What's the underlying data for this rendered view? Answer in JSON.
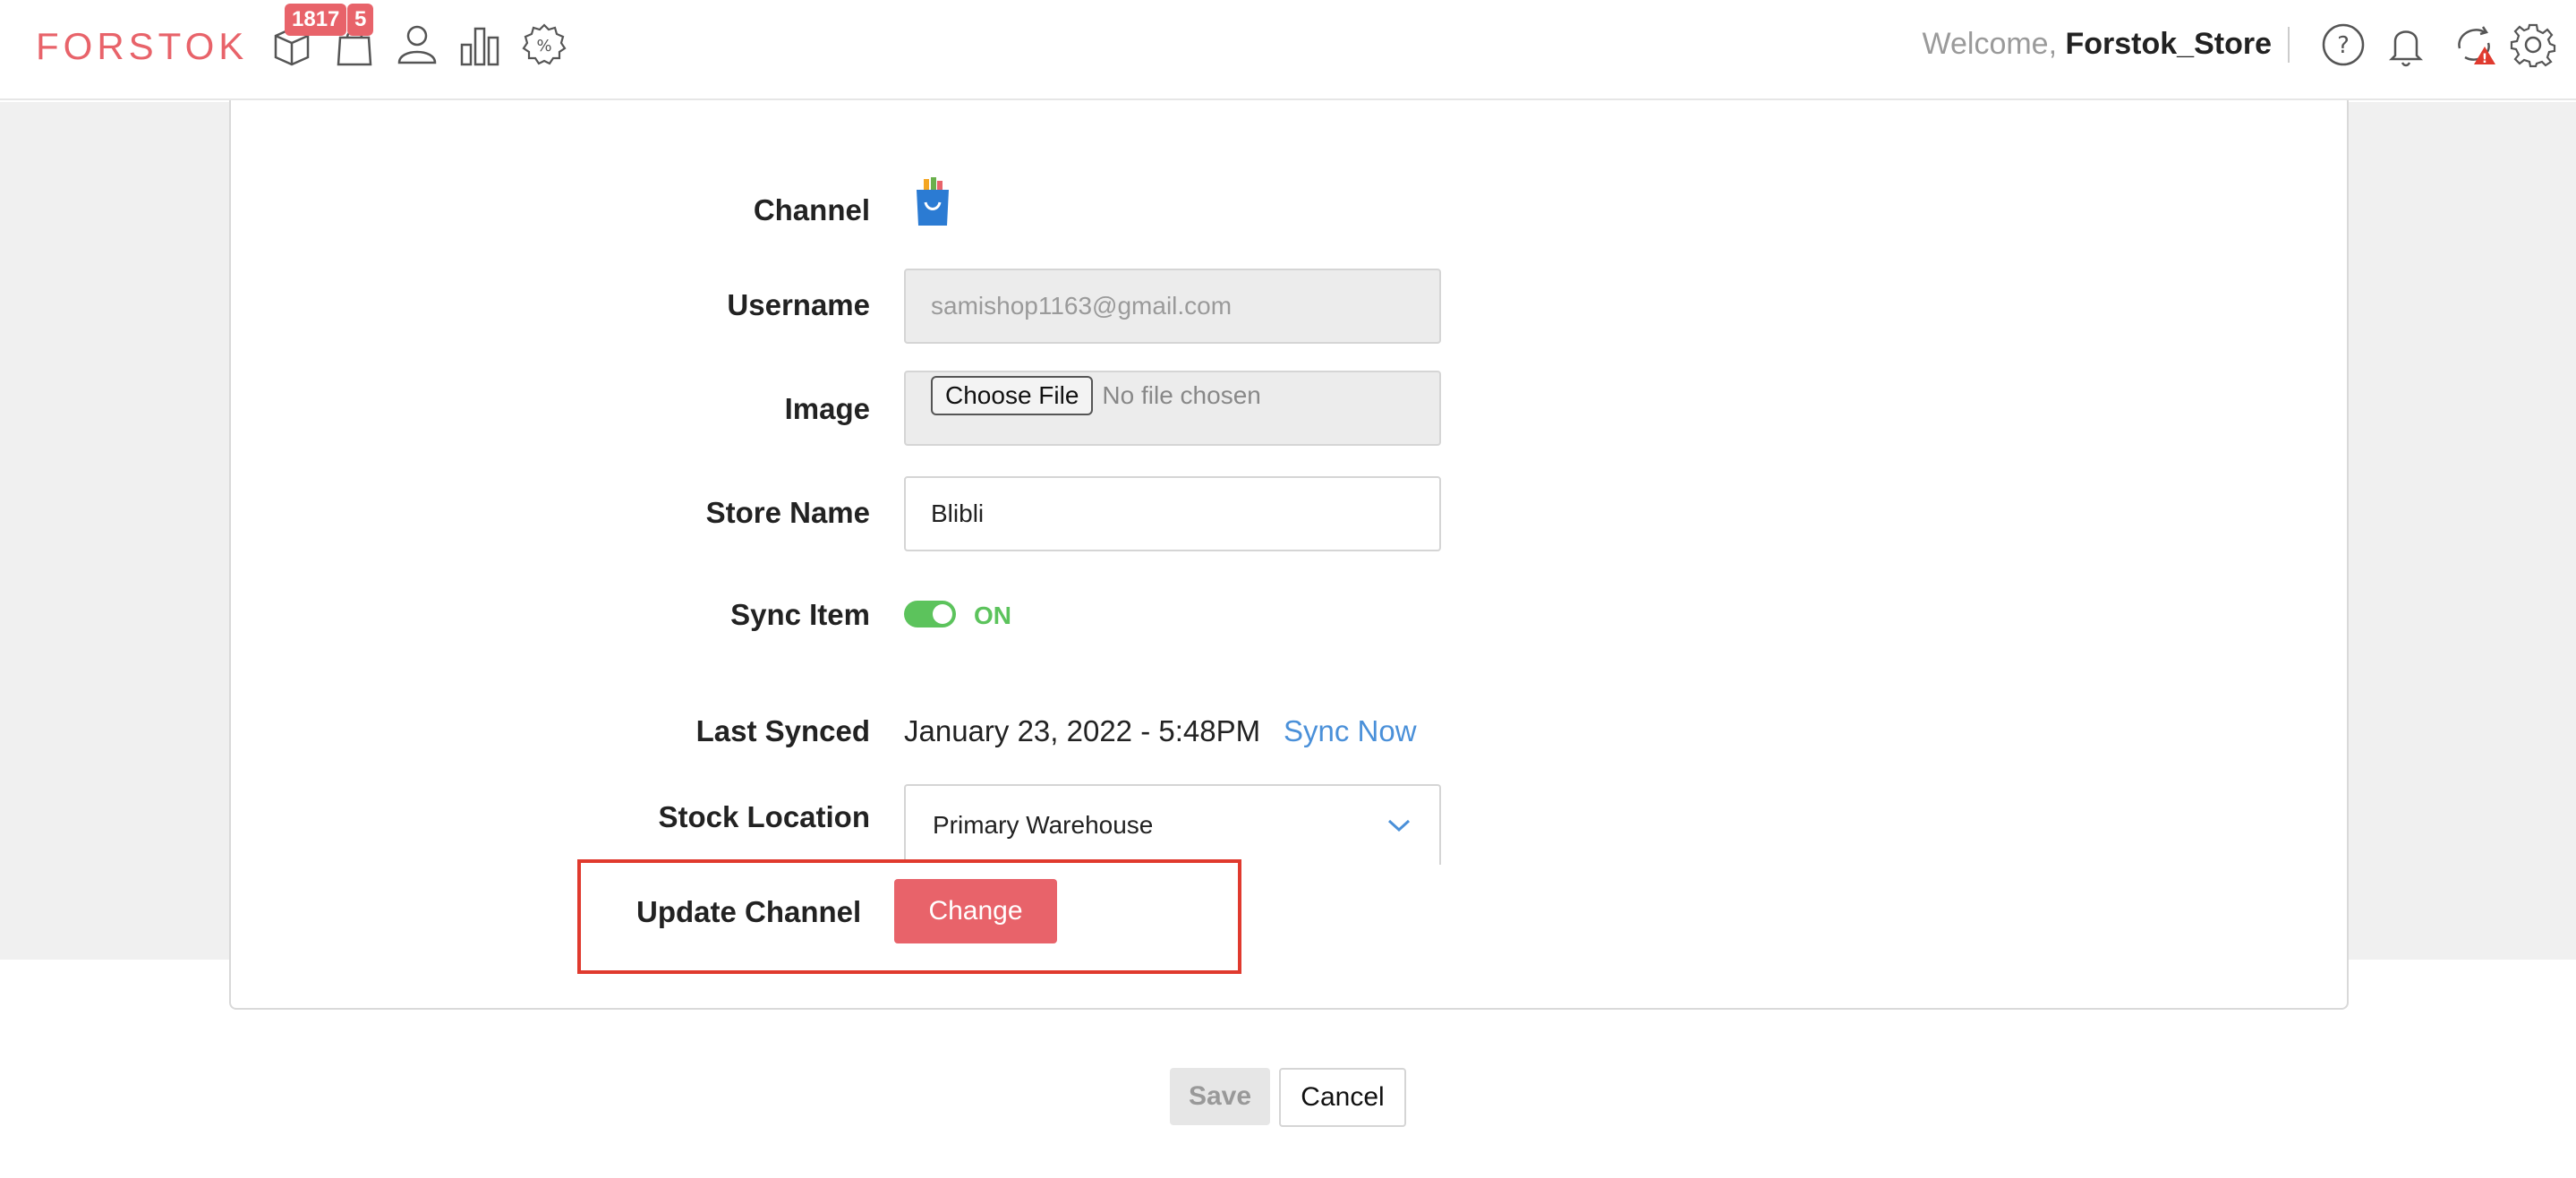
{
  "header": {
    "logo": "FORSTOK",
    "badges": {
      "products": "1817",
      "orders": "5"
    },
    "welcome_prefix": "Welcome,",
    "username": "Forstok_Store",
    "icons": [
      "box-icon",
      "shopping-bag-icon",
      "user-icon",
      "bar-chart-icon",
      "discount-badge-icon",
      "help-icon",
      "bell-icon",
      "sync-alert-icon",
      "gear-icon"
    ]
  },
  "form": {
    "channel": {
      "label": "Channel",
      "icon": "blibli-bag-icon"
    },
    "username": {
      "label": "Username",
      "value": "samishop1163@gmail.com"
    },
    "image": {
      "label": "Image",
      "button": "Choose File",
      "status": "No file chosen"
    },
    "store_name": {
      "label": "Store Name",
      "value": "Blibli"
    },
    "sync_item": {
      "label": "Sync Item",
      "state": "ON"
    },
    "last_synced": {
      "label": "Last Synced",
      "value": "January 23, 2022 - 5:48PM",
      "link": "Sync Now"
    },
    "stock_location": {
      "label": "Stock Location",
      "value": "Primary Warehouse"
    },
    "update_channel": {
      "label": "Update Channel",
      "button": "Change"
    }
  },
  "actions": {
    "save": "Save",
    "cancel": "Cancel"
  },
  "colors": {
    "brand": "#e8636a",
    "toggle_on": "#5cc35c",
    "link": "#4a90d9",
    "highlight": "#e03a2e"
  }
}
